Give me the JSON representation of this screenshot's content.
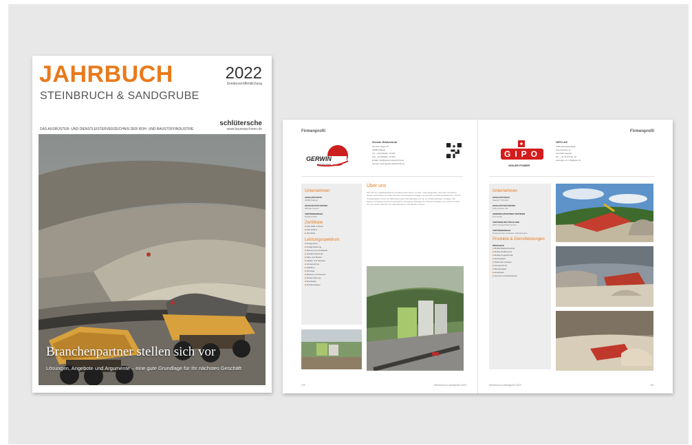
{
  "cover": {
    "title": "JAHRBUCH",
    "year": "2022",
    "special": "Sonderveröffentlichung",
    "subtitle": "STEINBRUCH & SANDGRUBE",
    "publisher": "schlütersche",
    "url": "www.baumaschinen.de",
    "tagline": "DAS AUSRÜSTER- UND DIENSTLEISTERVERZEICHNIS DER ROH- UND BAUSTOFFINDUSTRIE",
    "headline": "Branchenpartner stellen sich vor",
    "subline": "Lösungen, Angebote und Argumente – eine gute Grundlage für Ihr nächstes Geschäft"
  },
  "spread": {
    "header_left": "Firmenprofil",
    "header_right": "Firmenprofil",
    "left": {
      "logo_text": "GERWIN",
      "logo_sub": "SILOTECHNIK",
      "company": "Gerwin Silotechnik",
      "info": "Auf dem Tigge 15\n32689 Kalletal\nTel.: +49 (0)5261 / 97162\nFax: +49 (0)5261 / 97163\nE-Mail: info@gerwin-silotechnik.de\nInternet: www.gerwin-silotechnik.de",
      "sidebar": {
        "title": "Unternehmen",
        "fields": [
          {
            "label": "GESCHÄFTSSITZ",
            "value": "32689 Kalletal"
          },
          {
            "label": "GESCHÄFTSFÜHRUNG",
            "value": "Michael Gerwin"
          },
          {
            "label": "VERTRIEBSWEGE",
            "value": "Direktvertrieb"
          }
        ],
        "cert_title": "Zertifikate",
        "certs": [
          "DIN 1090-1 EXC2",
          "DIN 1090-3",
          "ISO 9001"
        ],
        "range_title": "Leistungsspektrum",
        "range": [
          "Anlagenbau",
          "Anlagenplanung",
          "Steuerung und Elektrik",
          "Verfahrenstechnik",
          "Silos und Bunker",
          "Halden und Siebbau",
          "Fördertechnik",
          "Stahlbau",
          "Montage",
          "Wartung und Service",
          "Modernisierung",
          "Ersatzteile",
          "Sonderanlagen"
        ]
      },
      "body_title": "Über uns",
      "body_text": "Wir sind ein mittelständisches Familienunternehmen im Silo- und Anlagenbau. Seit über 50 Jahren planen und fertigen wir Silos, Bunker und komplette Anlagen für die Roh- und Baustoffindustrie. Unsere Produktpalette reicht von Mörtelsilos über Schüttgutsilos bis hin zu schlüsselfertigen Anlagen. Mit eigenem Fachpersonal für Konstruktion, Fertigung, Montage und Service begleiten wir unsere Kunden von der ersten Idee bis zur Inbetriebnahme und darüber hinaus.",
      "page_no": "190",
      "page_label": "Steinbruch & Sandgrube 2022"
    },
    "right": {
      "logo_text": "GIPO",
      "logo_sub": "GISLER POWER",
      "company": "GIPO AG",
      "info": "Aufbereitungsanlagen\nKreuzstrasse 17\nCH-6462 Seedorf\nTel.: +41 41 874 81 10\nwww.gipo.ch, info@gipo.ch",
      "sidebar": {
        "title": "Unternehmen",
        "fields": [
          {
            "label": "GESCHÄFTSSITZ",
            "value": "Seedorf, Schweiz"
          },
          {
            "label": "GESCHÄFTSFÜHRUNG",
            "value": "Gisler Power AG"
          },
          {
            "label": "ANSPRECHPARTNER VERTRIEB",
            "value": "Kurt Gisler"
          },
          {
            "label": "VERTRIEB DEUTSCHLAND",
            "value": "GIPO Deutschland GmbH"
          },
          {
            "label": "VERTRIEBSWEGE",
            "value": "Direktvertrieb, weltweite Händlernetze"
          }
        ],
        "prod_title": "Produkte & Dienstleistungen",
        "prod_label": "PRODUKTE",
        "products": [
          "Mobile Backenbrecher",
          "Mobile Prallbrecher",
          "Mobile Kegelbrecher",
          "Siebanlagen",
          "Stationäre Anlagen",
          "Fördertechnik",
          "Bandanlagen",
          "Ersatzteile",
          "Service und Reparaturen"
        ]
      },
      "page_no": "191",
      "page_label": "Steinbruch & Sandgrube 2022"
    }
  },
  "colors": {
    "accent": "#e97a1c",
    "gerwin_red": "#cc1f1f",
    "gipo_red": "#d41c1c"
  }
}
